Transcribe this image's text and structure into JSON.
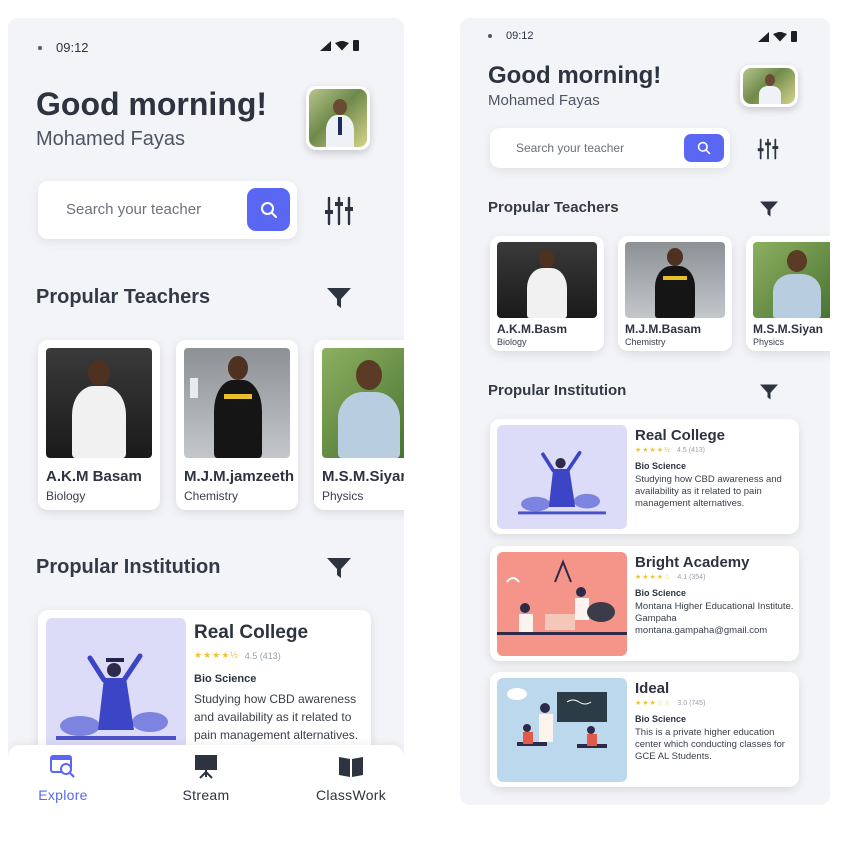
{
  "screenA": {
    "status": {
      "time": "09:12"
    },
    "greeting": "Good morning!",
    "user_name": "Mohamed Fayas",
    "search": {
      "placeholder": "Search your teacher"
    },
    "teachers_title": "Propular Teachers",
    "teachers": [
      {
        "name": "A.K.M Basam",
        "subject": "Biology"
      },
      {
        "name": "M.J.M.jamzeeth",
        "subject": "Chemistry"
      },
      {
        "name": "M.S.M.Siyan",
        "subject": "Physics"
      }
    ],
    "institutions_title": "Propular Institution",
    "institutions": [
      {
        "name": "Real College",
        "rating_stars": "★★★★½",
        "rating": "4.5 (413)",
        "subject": "Bio Science",
        "description": "Studying how CBD awareness and availability as it related to pain management alternatives."
      }
    ],
    "nav": [
      {
        "label": "Explore",
        "icon": "explore-icon",
        "active": true
      },
      {
        "label": "Stream",
        "icon": "stream-icon",
        "active": false
      },
      {
        "label": "ClassWork",
        "icon": "book-icon",
        "active": false
      }
    ]
  },
  "screenB": {
    "status": {
      "time": "09:12"
    },
    "greeting": "Good morning!",
    "user_name": "Mohamed Fayas",
    "search": {
      "placeholder": "Search your teacher"
    },
    "teachers_title": "Propular Teachers",
    "teachers": [
      {
        "name": "A.K.M.Basm",
        "subject": "Biology"
      },
      {
        "name": "M.J.M.Basam",
        "subject": "Chemistry"
      },
      {
        "name": "M.S.M.Siyan",
        "subject": "Physics"
      }
    ],
    "institutions_title": "Propular Institution",
    "institutions": [
      {
        "name": "Real College",
        "rating_stars": "★★★★½",
        "rating": "4.5 (413)",
        "subject": "Bio Science",
        "description": "Studying how CBD awareness and availability as it related to pain management alternatives."
      },
      {
        "name": "Bright Academy",
        "rating_stars": "★★★★☆",
        "rating": "4.1 (354)",
        "subject": "Bio Science",
        "description": "Montana Higher Educational Institute. Gampaha montana.gampaha@gmail.com"
      },
      {
        "name": "Ideal",
        "rating_stars": "★★★☆☆",
        "rating": "3.0 (745)",
        "subject": "Bio Science",
        "description": "This is a private higher education center which conducting classes for GCE AL Students."
      }
    ]
  },
  "colors": {
    "accent": "#5a67f2",
    "background": "#f3f4f8",
    "star": "#f2c230",
    "institution_purple": "#dcdcf8",
    "institution_salmon": "#f5958a",
    "institution_blue": "#bcd8ec"
  }
}
